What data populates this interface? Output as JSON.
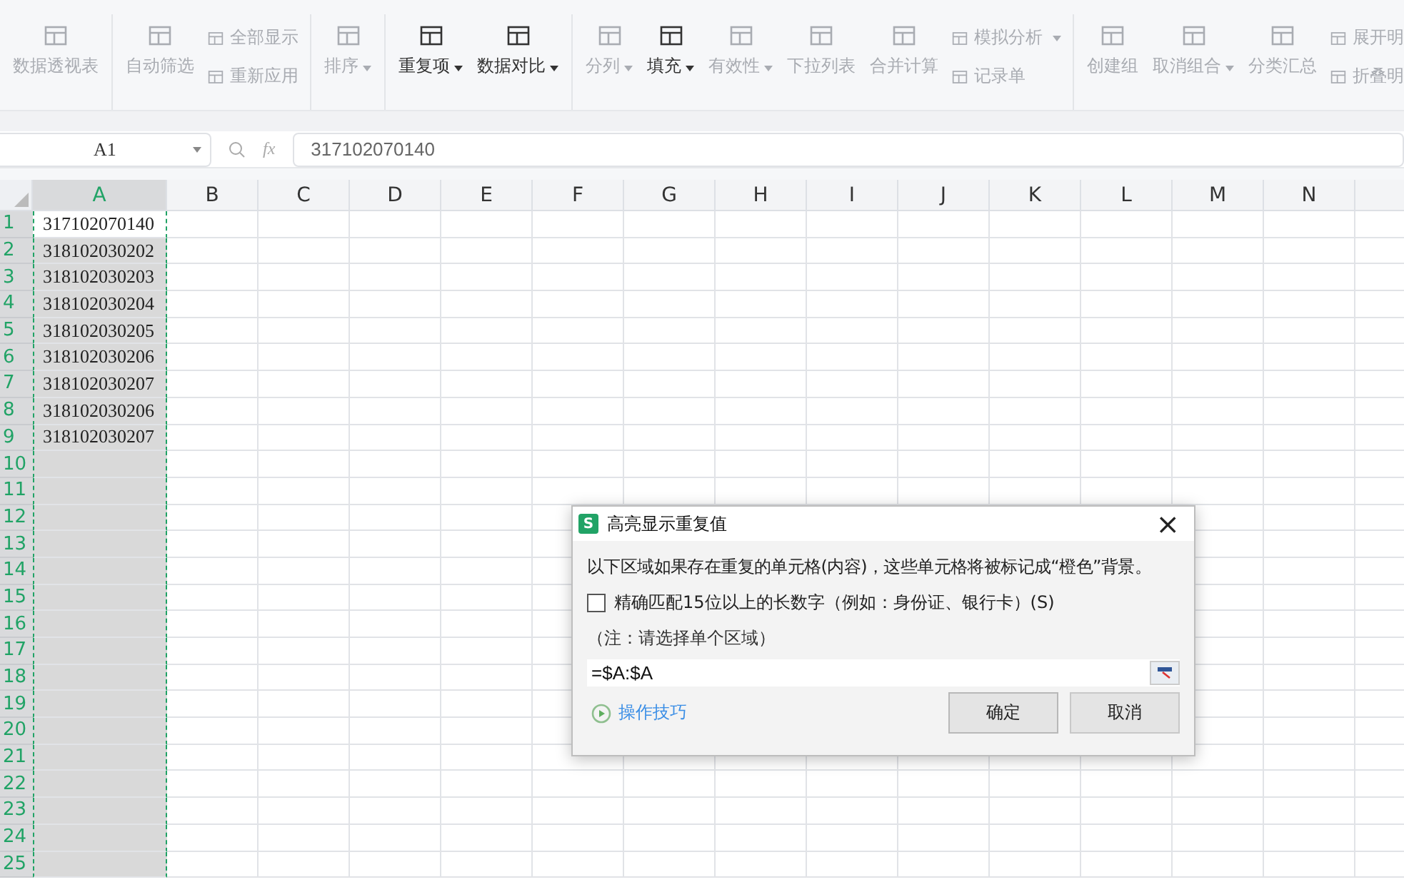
{
  "ribbon": {
    "groups": [
      {
        "items": [
          {
            "kind": "large",
            "label": "数据透视表",
            "dropdown": false,
            "disabled": true
          }
        ]
      },
      {
        "items": [
          {
            "kind": "large",
            "label": "自动筛选",
            "dropdown": false,
            "disabled": true
          },
          {
            "kind": "stack",
            "items": [
              {
                "label": "全部显示",
                "dropdown": false,
                "disabled": true
              },
              {
                "label": "重新应用",
                "dropdown": false,
                "disabled": true
              }
            ]
          }
        ]
      },
      {
        "items": [
          {
            "kind": "large",
            "label": "排序",
            "dropdown": true,
            "disabled": true
          }
        ]
      },
      {
        "items": [
          {
            "kind": "large",
            "label": "重复项",
            "dropdown": true,
            "disabled": false
          },
          {
            "kind": "large",
            "label": "数据对比",
            "dropdown": true,
            "disabled": false
          }
        ]
      },
      {
        "items": [
          {
            "kind": "large",
            "label": "分列",
            "dropdown": true,
            "disabled": true
          },
          {
            "kind": "large",
            "label": "填充",
            "dropdown": true,
            "disabled": false
          },
          {
            "kind": "large",
            "label": "有效性",
            "dropdown": true,
            "disabled": true
          },
          {
            "kind": "large",
            "label": "下拉列表",
            "dropdown": false,
            "disabled": true
          },
          {
            "kind": "large",
            "label": "合并计算",
            "dropdown": false,
            "disabled": true
          },
          {
            "kind": "stack",
            "items": [
              {
                "label": "模拟分析",
                "dropdown": true,
                "disabled": true
              },
              {
                "label": "记录单",
                "dropdown": false,
                "disabled": true
              }
            ]
          }
        ]
      },
      {
        "items": [
          {
            "kind": "large",
            "label": "创建组",
            "dropdown": false,
            "disabled": true
          },
          {
            "kind": "large",
            "label": "取消组合",
            "dropdown": true,
            "disabled": true
          },
          {
            "kind": "large",
            "label": "分类汇总",
            "dropdown": false,
            "disabled": true
          },
          {
            "kind": "stack",
            "items": [
              {
                "label": "展开明",
                "dropdown": false,
                "disabled": true
              },
              {
                "label": "折叠明",
                "dropdown": false,
                "disabled": true
              }
            ]
          }
        ]
      }
    ]
  },
  "formula_bar": {
    "name_box": "A1",
    "fx": "fx",
    "value": "317102070140"
  },
  "sheet": {
    "columns": [
      {
        "label": "A",
        "selected": true
      },
      {
        "label": "B",
        "selected": false
      },
      {
        "label": "C",
        "selected": false
      },
      {
        "label": "D",
        "selected": false
      },
      {
        "label": "E",
        "selected": false
      },
      {
        "label": "F",
        "selected": false
      },
      {
        "label": "G",
        "selected": false
      },
      {
        "label": "H",
        "selected": false
      },
      {
        "label": "I",
        "selected": false
      },
      {
        "label": "J",
        "selected": false
      },
      {
        "label": "K",
        "selected": false
      },
      {
        "label": "L",
        "selected": false
      },
      {
        "label": "M",
        "selected": false
      },
      {
        "label": "N",
        "selected": false
      }
    ],
    "rows": [
      "1",
      "2",
      "3",
      "4",
      "5",
      "6",
      "7",
      "8",
      "9",
      "10",
      "11",
      "12",
      "13",
      "14",
      "15",
      "16",
      "17",
      "18",
      "19",
      "20",
      "21",
      "22",
      "23",
      "24",
      "25"
    ],
    "column_a": [
      "317102070140",
      "318102030202",
      "318102030203",
      "318102030204",
      "318102030205",
      "318102030206",
      "318102030207",
      "318102030206",
      "318102030207"
    ]
  },
  "dialog": {
    "icon_letter": "S",
    "title": "高亮显示重复值",
    "close": "×",
    "message": "以下区域如果存在重复的单元格(内容)，这些单元格将被标记成“橙色”背景。",
    "checkbox": {
      "label": "精确匹配15位以上的长数字（例如：身份证、银行卡）(S)",
      "checked": false
    },
    "note": "（注：请选择单个区域）",
    "range": "=$A:$A",
    "tips_link": "操作技巧",
    "buttons": [
      {
        "label": "确定",
        "kind": "primary"
      },
      {
        "label": "取消",
        "kind": "secondary"
      }
    ]
  }
}
